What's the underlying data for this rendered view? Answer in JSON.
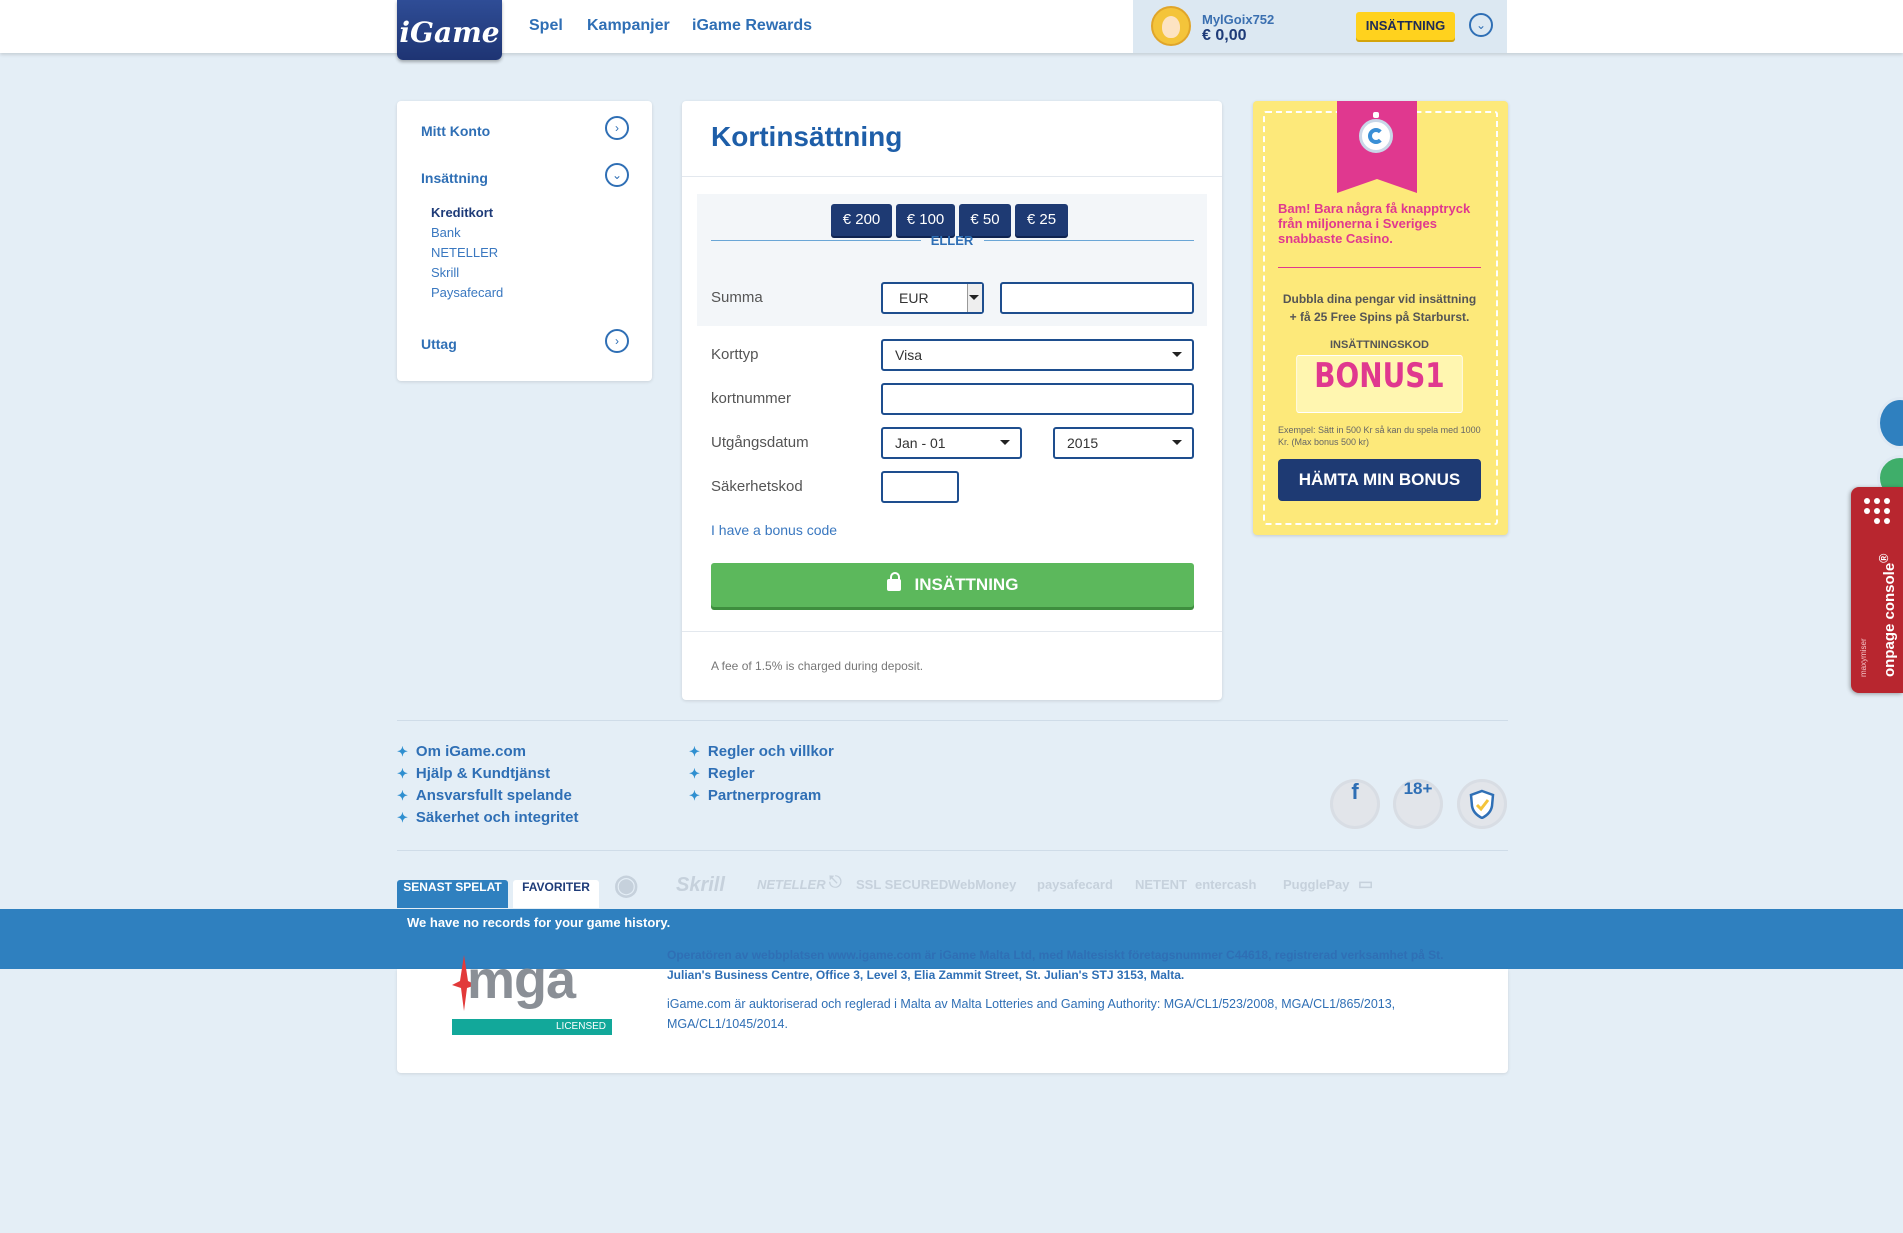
{
  "header": {
    "logo_text": "iGame",
    "nav": [
      "Spel",
      "Kampanjer",
      "iGame Rewards"
    ],
    "username": "MylGoix752",
    "balance": "€ 0,00",
    "deposit_button": "INSÄTTNING"
  },
  "sidebar": {
    "account": "Mitt Konto",
    "deposit": "Insättning",
    "methods": [
      "Kreditkort",
      "Bank",
      "NETELLER",
      "Skrill",
      "Paysafecard"
    ],
    "withdraw": "Uttag"
  },
  "main": {
    "title": "Kortinsättning",
    "amount_chips": [
      "€ 200",
      "€ 100",
      "€ 50",
      "€ 25"
    ],
    "or": "ELLER",
    "labels": {
      "amount": "Summa",
      "card_type": "Korttyp",
      "card_number": "kortnummer",
      "expiry": "Utgångsdatum",
      "cvv": "Säkerhetskod"
    },
    "currency": "EUR",
    "amount_value": "",
    "card_type_value": "Visa",
    "card_number_value": "",
    "expiry_month": "Jan - 01",
    "expiry_year": "2015",
    "cvv_value": "",
    "bonus_link": "I have a bonus code",
    "submit": "INSÄTTNING",
    "fee_note": "A fee of 1.5% is charged during deposit."
  },
  "promo": {
    "headline": "Bam! Bara några få knapptryck från miljonerna i Sveriges snabbaste Casino.",
    "offer": "Dubbla dina pengar vid insättning + få 25 Free Spins på Starburst.",
    "code_label": "INSÄTTNINGSKOD",
    "code": "BONUS1",
    "example": "Exempel: Sätt in 500 Kr så kan du spela med 1000 Kr. (Max bonus 500 kr)",
    "button": "HÄMTA MIN BONUS"
  },
  "footer": {
    "links_left": [
      "Om iGame.com",
      "Hjälp & Kundtjänst",
      "Ansvarsfullt spelande",
      "Säkerhet och integritet"
    ],
    "links_right": [
      "Regler och villkor",
      "Regler",
      "Partnerprogram"
    ],
    "age": "18+",
    "payment_logos": [
      "Skrill",
      "NETELLER",
      "SSL SECURED",
      "WebMoney",
      "paysafecard",
      "NETENT",
      "entercash",
      "PugglePay"
    ],
    "tabs": [
      "SENAST SPELAT",
      "FAVORITER"
    ],
    "no_history": "We have no records for your game history.",
    "mga_logo": "mga",
    "mga_licensed": "LICENSED",
    "operator": "Operatören av webbplatsen www.igame.com är iGame Malta Ltd, med Maltesiskt företagsnummer C44618, registrerad verksamhet på St. Julian's Business Centre, Office 3, Level 3, Elia Zammit Street, St. Julian's STJ 3153, Malta.",
    "legal": "iGame.com är auktoriserad och reglerad i Malta av Malta Lotteries and Gaming Authority: MGA/CL1/523/2008, MGA/CL1/865/2013, MGA/CL1/1045/2014."
  },
  "side_widget": {
    "title": "onpage console",
    "registered": "®",
    "small": "maxymiser"
  }
}
